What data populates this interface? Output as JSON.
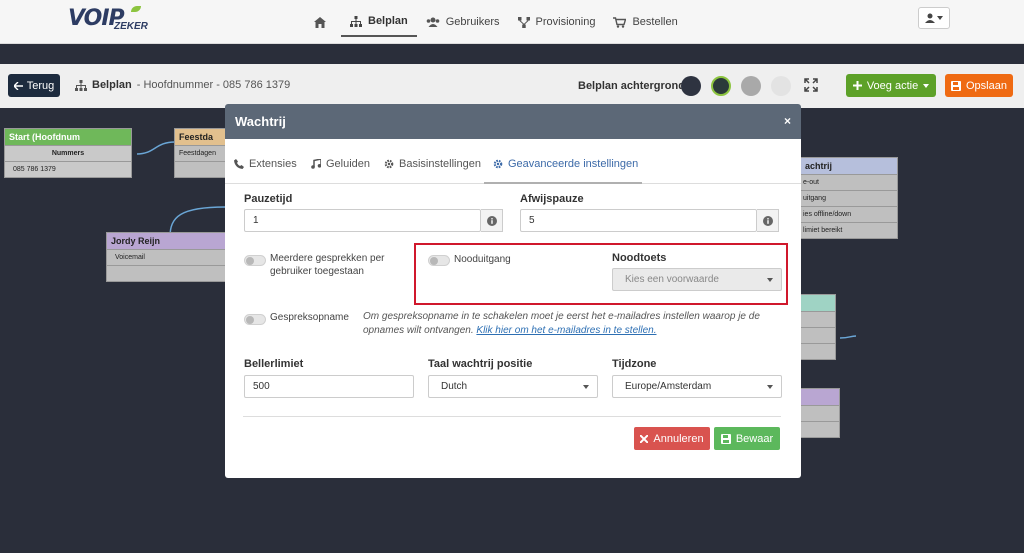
{
  "nav": {
    "logo_main": "VOIP",
    "logo_sub": "ZEKER",
    "items": [
      {
        "label": ""
      },
      {
        "label": "Belplan"
      },
      {
        "label": "Gebruikers"
      },
      {
        "label": "Provisioning"
      },
      {
        "label": "Bestellen"
      }
    ]
  },
  "toolbar": {
    "back_label": "Terug",
    "crumb_title": "Belplan",
    "crumb_sub": "- Hoofdnummer - 085 786 1379",
    "bg_label": "Belplan achtergrond",
    "swatches": [
      "#2e3340",
      "#2b3a3a",
      "#a9a9a9",
      "#e3e3e3"
    ],
    "add_label": "Voeg actie",
    "save_label": "Opslaan"
  },
  "canvas": {
    "node_start_title": "Start (Hoofdnum",
    "node_start_row1": "Nummers",
    "node_start_row2": "085 786 1379",
    "node_feest_title": "Feestda",
    "node_feest_row": "Feestdagen",
    "node_jordy_title": "Jordy Reijn",
    "node_jordy_row": "Voicemail",
    "node_wachtrij_title": "achtrij",
    "node_wachtrij_rows": [
      "e-out",
      "uitgang",
      "ies offline/down",
      "limiet bereikt"
    ]
  },
  "modal": {
    "title": "Wachtrij",
    "close": "×",
    "tabs": [
      "Extensies",
      "Geluiden",
      "Basisinstellingen",
      "Geavanceerde instellingen"
    ],
    "pauzetijd_label": "Pauzetijd",
    "pauzetijd_value": "1",
    "afwijspauze_label": "Afwijspauze",
    "afwijspauze_value": "5",
    "meerdere_label": "Meerdere gesprekken per gebruiker toegestaan",
    "nooduitgang_label": "Nooduitgang",
    "noodtoets_label": "Noodtoets",
    "noodtoets_placeholder": "Kies een voorwaarde",
    "gespreksopname_label": "Gespreksopname",
    "note_text": "Om gespreksopname in te schakelen moet je eerst het e-mailadres instellen waarop je de opnames wilt ontvangen. ",
    "note_link": "Klik hier om het e-mailadres in te stellen.",
    "bellerlimiet_label": "Bellerlimiet",
    "bellerlimiet_value": "500",
    "taal_label": "Taal wachtrij positie",
    "taal_value": "Dutch",
    "tijdzone_label": "Tijdzone",
    "tijdzone_value": "Europe/Amsterdam",
    "cancel_label": "Annuleren",
    "bewaar_label": "Bewaar"
  }
}
